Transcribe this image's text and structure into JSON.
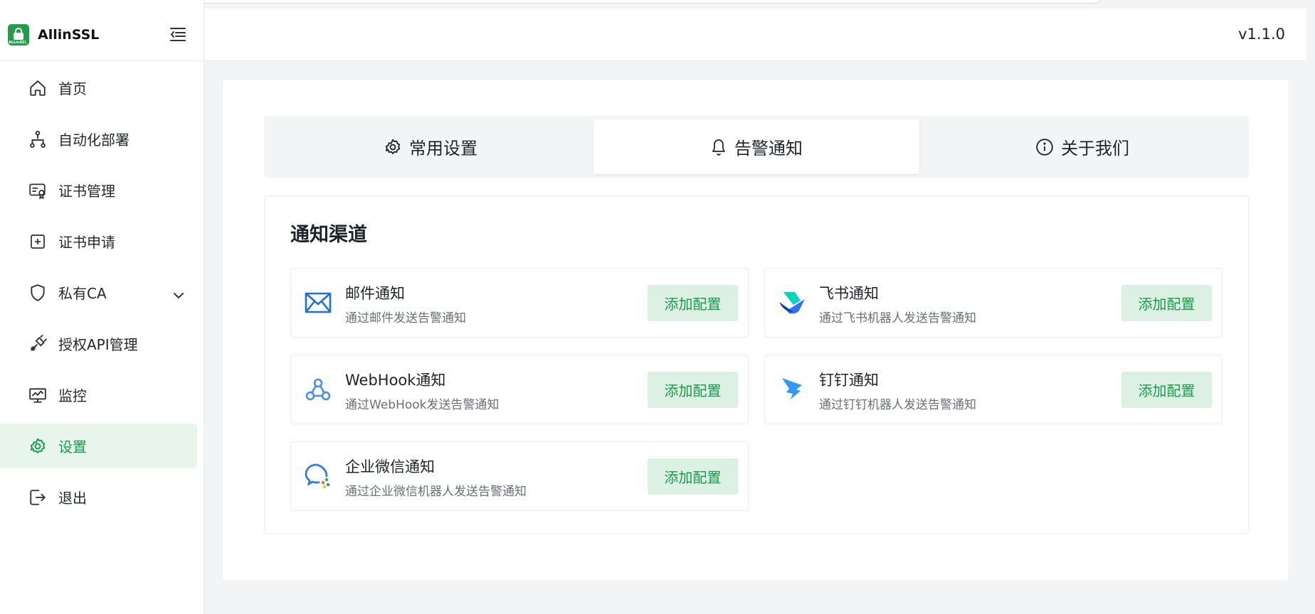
{
  "app": {
    "name": "AllinSSL",
    "logo_text": "ALLinSSL",
    "version": "v1.1.0"
  },
  "sidebar": {
    "items": [
      {
        "label": "首页",
        "icon": "home-icon"
      },
      {
        "label": "自动化部署",
        "icon": "workflow-icon"
      },
      {
        "label": "证书管理",
        "icon": "certificate-icon"
      },
      {
        "label": "证书申请",
        "icon": "plus-square-icon"
      },
      {
        "label": "私有CA",
        "icon": "shield-icon"
      },
      {
        "label": "授权API管理",
        "icon": "api-plug-icon"
      },
      {
        "label": "监控",
        "icon": "monitor-icon"
      },
      {
        "label": "设置",
        "icon": "gear-icon",
        "active": true
      },
      {
        "label": "退出",
        "icon": "logout-icon"
      }
    ]
  },
  "tabs": [
    {
      "label": "常用设置",
      "icon": "gear-icon"
    },
    {
      "label": "告警通知",
      "icon": "bell-icon",
      "active": true
    },
    {
      "label": "关于我们",
      "icon": "info-icon"
    }
  ],
  "section": {
    "title": "通知渠道",
    "channels": [
      {
        "name": "邮件通知",
        "desc": "通过邮件发送告警通知",
        "button": "添加配置",
        "icon": "mail-icon"
      },
      {
        "name": "飞书通知",
        "desc": "通过飞书机器人发送告警通知",
        "button": "添加配置",
        "icon": "feishu-icon"
      },
      {
        "name": "WebHook通知",
        "desc": "通过WebHook发送告警通知",
        "button": "添加配置",
        "icon": "webhook-icon"
      },
      {
        "name": "钉钉通知",
        "desc": "通过钉钉机器人发送告警通知",
        "button": "添加配置",
        "icon": "dingtalk-icon"
      },
      {
        "name": "企业微信通知",
        "desc": "通过企业微信机器人发送告警通知",
        "button": "添加配置",
        "icon": "wecom-icon"
      }
    ]
  },
  "colors": {
    "accent": "#189b4c",
    "accent_bg": "#dcf1e3",
    "active_bg": "#e7f5ec"
  }
}
